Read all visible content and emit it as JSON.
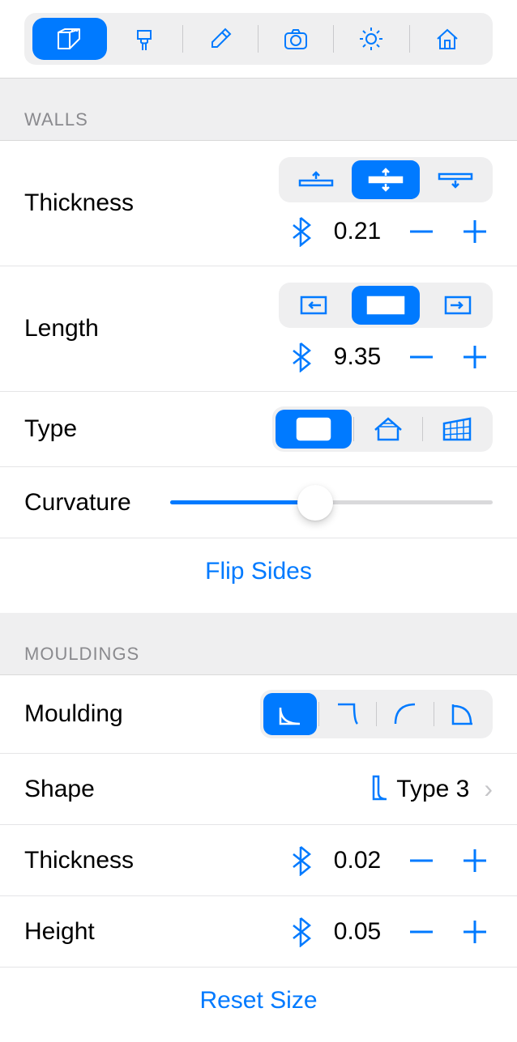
{
  "sections": {
    "walls_header": "WALLS",
    "mouldings_header": "MOULDINGS"
  },
  "walls": {
    "thickness_label": "Thickness",
    "thickness_value": "0.21",
    "length_label": "Length",
    "length_value": "9.35",
    "type_label": "Type",
    "curvature_label": "Curvature",
    "curvature_percent": 45,
    "flip_label": "Flip Sides"
  },
  "mouldings": {
    "moulding_label": "Moulding",
    "shape_label": "Shape",
    "shape_value": "Type 3",
    "thickness_label": "Thickness",
    "thickness_value": "0.02",
    "height_label": "Height",
    "height_value": "0.05",
    "reset_label": "Reset Size"
  }
}
